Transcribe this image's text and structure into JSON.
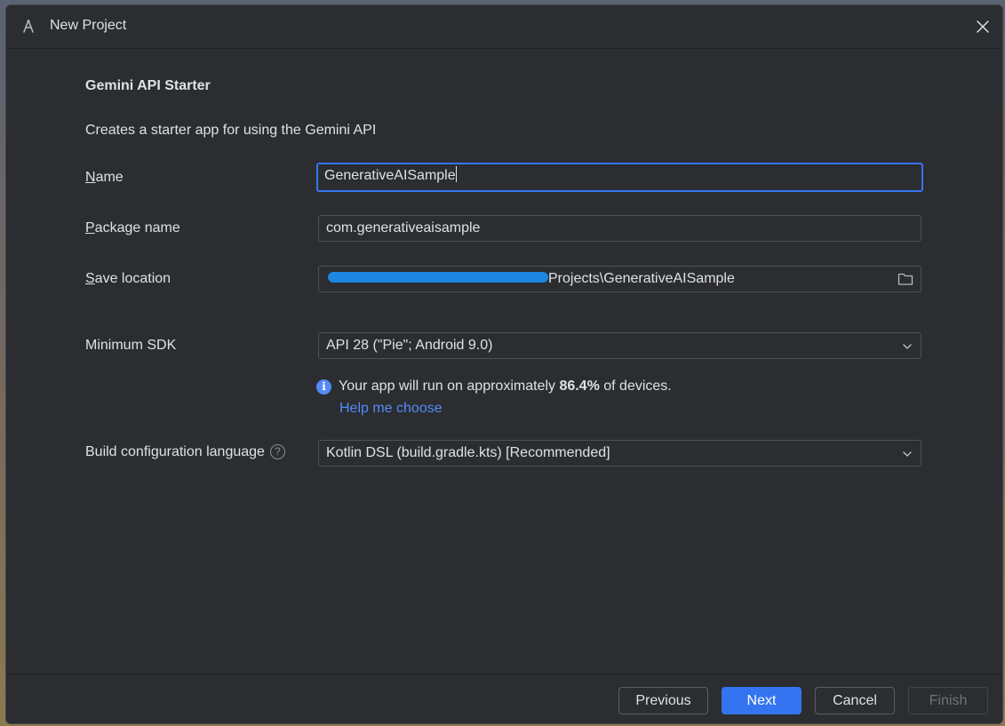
{
  "window": {
    "title": "New Project"
  },
  "template": {
    "heading": "Gemini API Starter",
    "description": "Creates a starter app for using the Gemini API"
  },
  "form": {
    "name": {
      "label_mnemonic": "N",
      "label_rest": "ame",
      "value": "GenerativeAISample"
    },
    "package": {
      "label_mnemonic": "P",
      "label_rest": "ackage name",
      "value": "com.generativeaisample"
    },
    "save_location": {
      "label_mnemonic": "S",
      "label_rest": "ave location",
      "value_visible": "Projects\\GenerativeAISample"
    },
    "min_sdk": {
      "label": "Minimum SDK",
      "value": "API 28 (\"Pie\"; Android 9.0)"
    },
    "info": {
      "prefix": "Your app will run on approximately ",
      "percent": "86.4%",
      "suffix": " of devices.",
      "link": "Help me choose"
    },
    "build_lang": {
      "label": "Build configuration language",
      "value": "Kotlin DSL (build.gradle.kts) [Recommended]"
    }
  },
  "buttons": {
    "previous": "Previous",
    "next": "Next",
    "cancel": "Cancel",
    "finish": "Finish"
  },
  "colors": {
    "accent": "#3574f0",
    "link": "#548af7",
    "background": "#2b2d30"
  }
}
